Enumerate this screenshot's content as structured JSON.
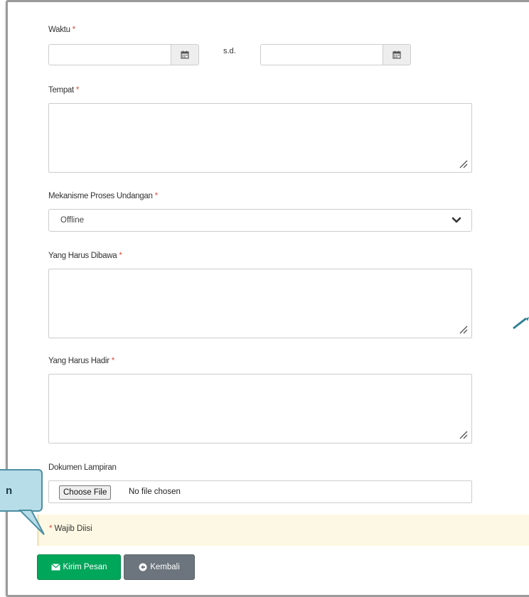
{
  "form": {
    "waktu_label": "Waktu",
    "waktu_separator": "s.d.",
    "waktu_start_value": "",
    "waktu_end_value": "",
    "tempat_label": "Tempat",
    "tempat_value": "",
    "mekanisme_label": "Mekanisme Proses Undangan",
    "mekanisme_value": "Offline",
    "dibawa_label": "Yang Harus Dibawa",
    "dibawa_value": "",
    "hadir_label": "Yang Harus Hadir",
    "hadir_value": "",
    "lampiran_label": "Dokumen Lampiran",
    "file_button_label": "Choose File",
    "file_status": "No file chosen",
    "required_marker": "*",
    "required_note": "Wajib Diisi"
  },
  "buttons": {
    "send_label": "Kirim Pesan",
    "back_label": "Kembali"
  },
  "callout": {
    "text": "n"
  },
  "icons": {
    "calendar": "calendar-icon",
    "resize": "resize-grip-icon",
    "chevron": "chevron-down-icon",
    "send": "envelope-icon",
    "back": "circle-arrow-left-icon"
  },
  "colors": {
    "required": "#dd4b39",
    "send_button": "#00a65a",
    "back_button": "#6c757d",
    "warning_bg": "#fcf8e3",
    "callout_bg": "#b7dde8",
    "callout_border": "#4d8fa3"
  }
}
